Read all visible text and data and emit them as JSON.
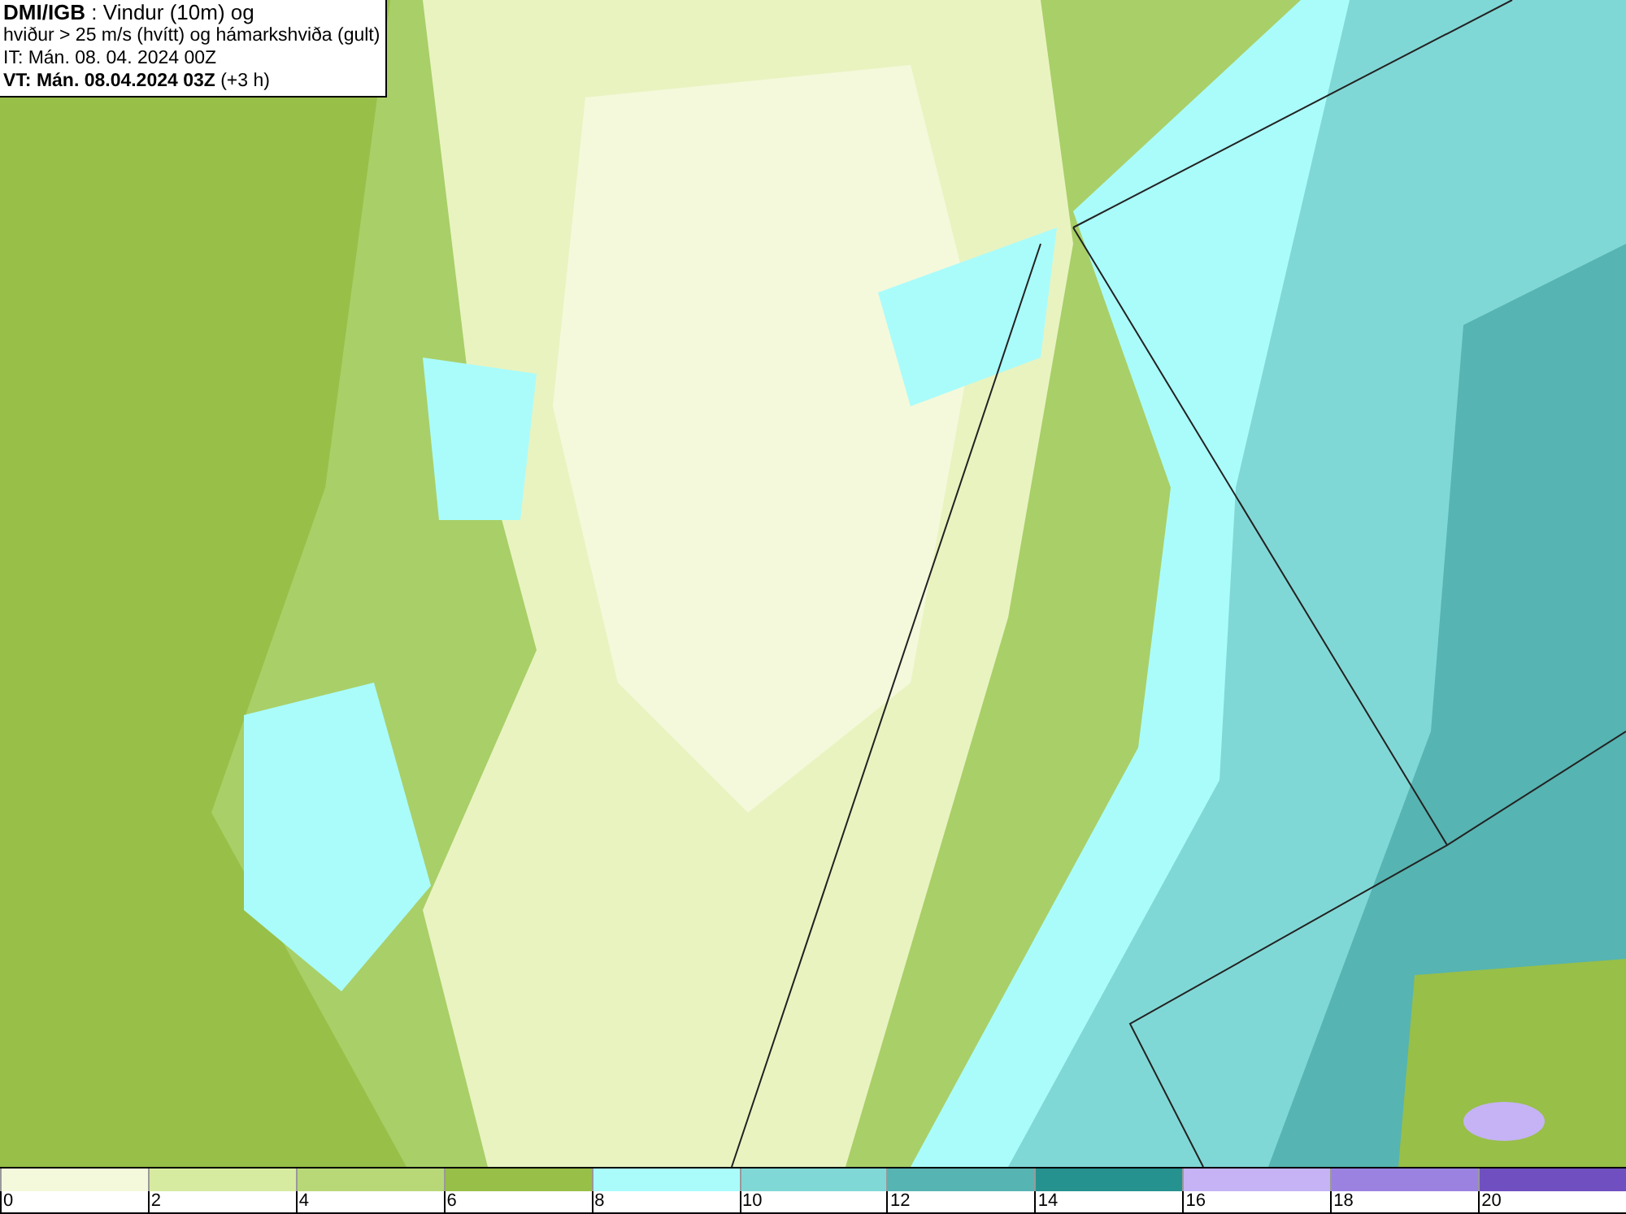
{
  "title_box": {
    "lines": [
      "**DMI/IGB** : Vindur (10m) og",
      "hviður > 25 m/s (hvítt) og hámarkshviða (gult)",
      "IT: Mán. 08. 04. 2024 00Z",
      "**VT: Mán. 08.04.2024 03Z** (+3 h)"
    ]
  },
  "legend": [
    {
      "label": "0",
      "color": "#f4f9dc"
    },
    {
      "label": "2",
      "color": "#d6eba0"
    },
    {
      "label": "4",
      "color": "#b8d878"
    },
    {
      "label": "6",
      "color": "#98bf48"
    },
    {
      "label": "8",
      "color": "#aafcfa"
    },
    {
      "label": "10",
      "color": "#80d8d6"
    },
    {
      "label": "12",
      "color": "#56b4b2"
    },
    {
      "label": "14",
      "color": "#259290"
    },
    {
      "label": "16",
      "color": "#c5b3f5"
    },
    {
      "label": "18",
      "color": "#9b82e0"
    },
    {
      "label": "20",
      "color": "#7050c0"
    }
  ]
}
